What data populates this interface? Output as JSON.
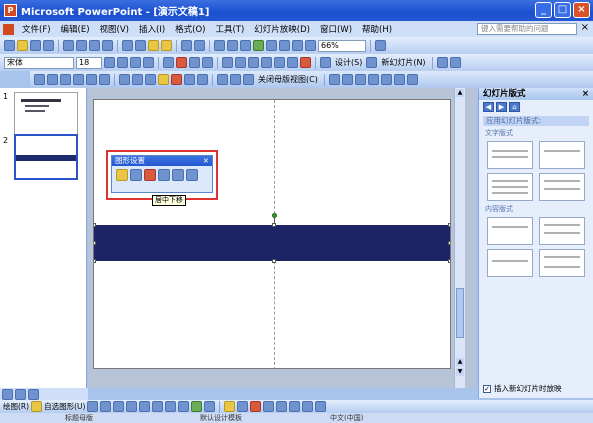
{
  "window": {
    "title": "Microsoft PowerPoint - [演示文稿1]",
    "min_label": "_",
    "max_label": "□",
    "close_label": "×"
  },
  "menu": {
    "items": [
      "文件(F)",
      "编辑(E)",
      "视图(V)",
      "插入(I)",
      "格式(O)",
      "工具(T)",
      "幻灯片放映(D)",
      "窗口(W)",
      "帮助(H)"
    ],
    "help_placeholder": "键入需要帮助的问题",
    "close_label": "×"
  },
  "toolbar": {
    "zoom": "66%",
    "font_name": "宋体",
    "font_size": "18",
    "design_label": "设计(S)",
    "new_slide_label": "新幻灯片(N)",
    "close_master_label": "关闭母版视图(C)"
  },
  "outline": {
    "slide_numbers": [
      "1",
      "2"
    ]
  },
  "floating_toolbar": {
    "title": "图形设置",
    "close_label": "×",
    "tooltip": "居中下移"
  },
  "task_pane": {
    "title": "幻灯片版式",
    "close_label": "×",
    "section_1": "应用幻灯片版式:",
    "sub_1": "文字版式",
    "sub_2": "内容版式",
    "check_label": "插入新幻灯片时放映"
  },
  "drawing_toolbar": {
    "draw_label": "绘图(R)",
    "autoshape_label": "自选图形(U)"
  },
  "status": {
    "left": "标题母版",
    "middle": "默认设计模板",
    "right": "中文(中国)"
  },
  "colors": {
    "accent_band": "#1d2465",
    "title_bar": "#2457d2",
    "highlight_border": "#dd3333"
  }
}
